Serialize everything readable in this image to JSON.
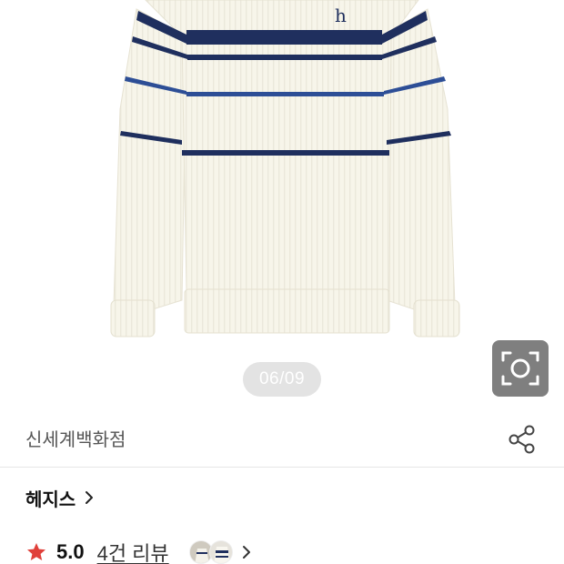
{
  "gallery": {
    "indicator": "06/09",
    "logo_text": "h"
  },
  "icons": {
    "lens": "camera-lens-icon",
    "share": "share-icon",
    "chevron": "chevron-right-icon",
    "star": "star-icon"
  },
  "seller": {
    "name": "신세계백화점"
  },
  "brand": {
    "name": "헤지스"
  },
  "rating": {
    "score": "5.0",
    "reviews_label": "4건 리뷰"
  },
  "colors": {
    "sweater": "#f7f5ea",
    "stripe_navy": "#1f2f5e",
    "stripe_blue": "#2d4e96",
    "star": "#e0403a",
    "lens_bg": "#7f7f7f"
  }
}
